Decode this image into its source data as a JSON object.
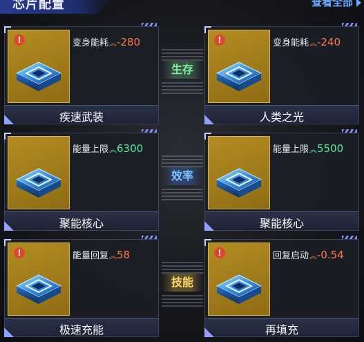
{
  "header": {
    "title": "芯片配置",
    "view_all": "查看全部"
  },
  "categories": {
    "survival": "生存",
    "efficiency": "效率",
    "skill": "技能"
  },
  "colors": {
    "chip_bg": "#b38d22",
    "negative_stat": "#ff7a4a",
    "positive_stat": "#52f0a0",
    "accent": "#7c8cff"
  },
  "chips": [
    {
      "name": "疾速武装",
      "stat_label": "变身能耗",
      "stat_value": "-280",
      "trend": "red",
      "warning": true
    },
    {
      "name": "人类之光",
      "stat_label": "变身能耗",
      "stat_value": "-240",
      "trend": "red",
      "warning": true
    },
    {
      "name": "聚能核心",
      "stat_label": "能量上限",
      "stat_value": "6300",
      "trend": "green",
      "warning": false
    },
    {
      "name": "聚能核心",
      "stat_label": "能量上限",
      "stat_value": "5500",
      "trend": "green",
      "warning": false
    },
    {
      "name": "极速充能",
      "stat_label": "能量回复",
      "stat_value": "58",
      "trend": "red",
      "warning": true
    },
    {
      "name": "再填充",
      "stat_label": "回复启动",
      "stat_value": "-0.54",
      "trend": "red",
      "warning": true
    }
  ],
  "icons": {
    "warning": "warning-icon",
    "chip": "chip-icon",
    "arrow_up": "double-chevron-up-icon"
  }
}
